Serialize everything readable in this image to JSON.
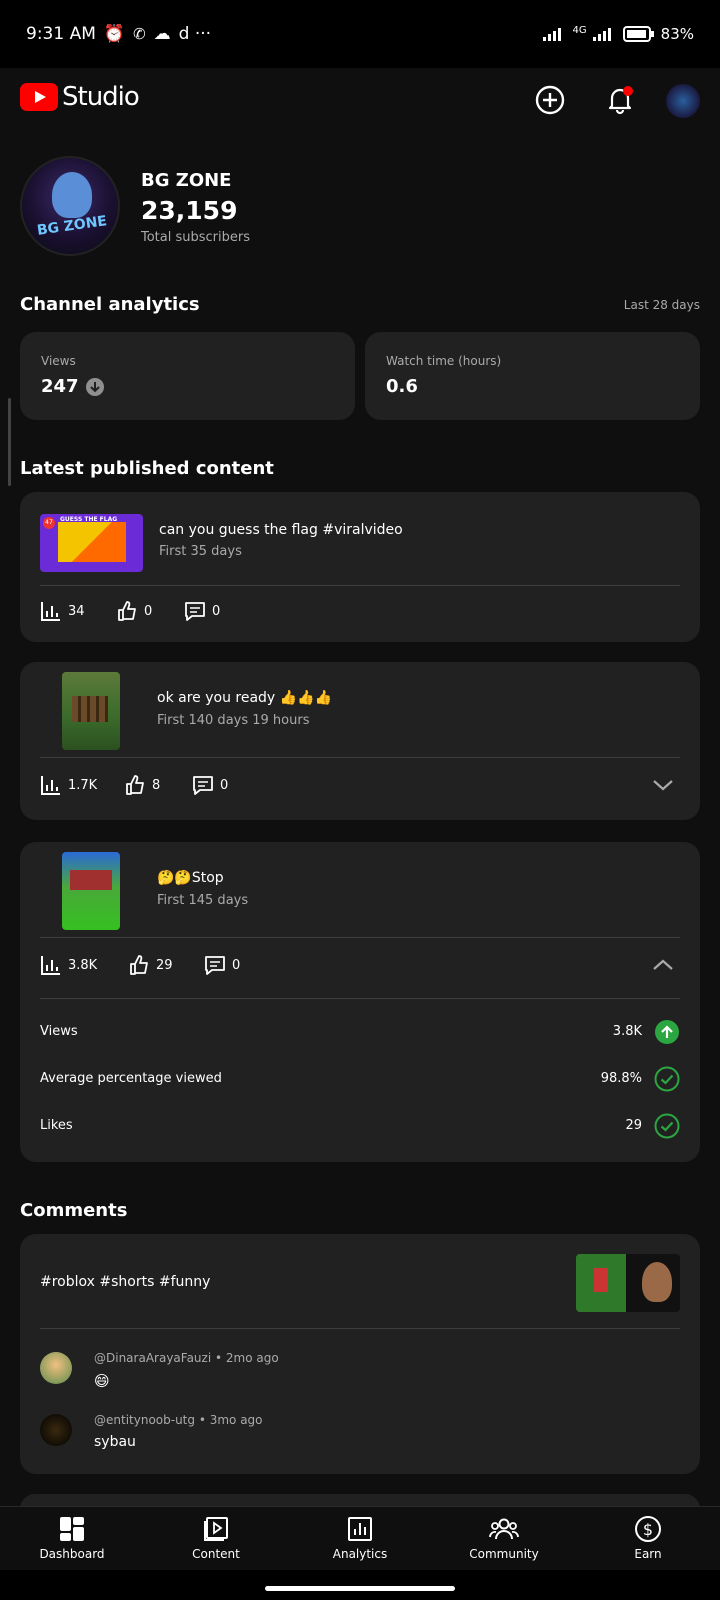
{
  "status_bar": {
    "time": "9:31 AM",
    "extra": "d ···",
    "network": "4G",
    "battery": "83%"
  },
  "app_bar": {
    "brand": "Studio",
    "brand_color": "#ff0000"
  },
  "channel": {
    "name": "BG ZONE",
    "avatar_text": "BG ZONE",
    "subscribers": "23,159",
    "subscribers_label": "Total subscribers"
  },
  "analytics": {
    "title": "Channel analytics",
    "period": "Last 28 days",
    "views_label": "Views",
    "views_value": "247",
    "watch_label": "Watch time (hours)",
    "watch_value": "0.6"
  },
  "latest": {
    "title": "Latest published content",
    "items": [
      {
        "title": "can you guess the flag #viralvideo",
        "subtitle": "First 35 days",
        "thumb_text": "GUESS THE FLAG",
        "badge": "47",
        "views": "34",
        "likes": "0",
        "comments": "0"
      },
      {
        "title": "ok are you ready 👍👍👍",
        "subtitle": "First 140 days 19 hours",
        "views": "1.7K",
        "likes": "8",
        "comments": "0"
      },
      {
        "title": "🤔🤔Stop",
        "subtitle": "First 145 days",
        "views": "3.8K",
        "likes": "29",
        "comments": "0",
        "metrics": [
          {
            "label": "Views",
            "value": "3.8K",
            "status": "arrow-up"
          },
          {
            "label": "Average percentage viewed",
            "value": "98.8%",
            "status": "check"
          },
          {
            "label": "Likes",
            "value": "29",
            "status": "check"
          }
        ]
      }
    ]
  },
  "comments": {
    "title": "Comments",
    "video_title": "#roblox #shorts #funny",
    "list": [
      {
        "author": "@DinaraArayaFauzi",
        "time": "2mo ago",
        "text": "😄"
      },
      {
        "author": "@entitynoob-utg",
        "time": "3mo ago",
        "text": "sybau"
      }
    ]
  },
  "bottom_nav": [
    "Dashboard",
    "Content",
    "Analytics",
    "Community",
    "Earn"
  ],
  "colors": {
    "success": "#2ba640",
    "accent_red": "#ff0000"
  }
}
